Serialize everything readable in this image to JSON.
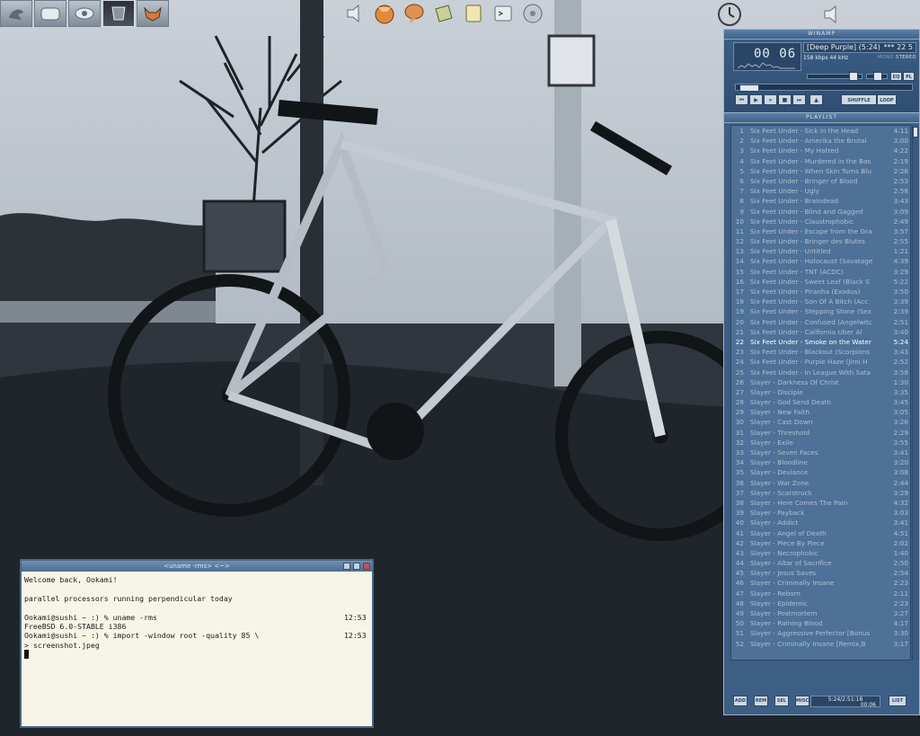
{
  "winamp": {
    "title": "WINAMP",
    "time": "00 06",
    "song": "[Deep Purple] (5:24)",
    "song_extra": "*** 22 5",
    "kbps": "158 kbps  44 kHz",
    "mono": "MONO",
    "stereo": "STEREO",
    "eq_label": "EQ",
    "pl_label": "PL",
    "shuffle_label": "SHUFFLE",
    "loop_label": "LOOP",
    "transport": [
      "⏮",
      "▶",
      "⏸",
      "■",
      "⏭",
      "▲"
    ],
    "position_fraction": 0.02
  },
  "playlist": {
    "title": "PLAYLIST",
    "current_index": 22,
    "items": [
      {
        "n": "1",
        "title": "Six Feet Under - Sick in the Head",
        "dur": "4:11"
      },
      {
        "n": "2",
        "title": "Six Feet Under - Amerika the Brutal",
        "dur": "3:00"
      },
      {
        "n": "3",
        "title": "Six Feet Under - My Hatred",
        "dur": "4:22"
      },
      {
        "n": "4",
        "title": "Six Feet Under - Murdered in the Bas",
        "dur": "2:19"
      },
      {
        "n": "5",
        "title": "Six Feet Under - When Skin Turns Blu",
        "dur": "2:26"
      },
      {
        "n": "6",
        "title": "Six Feet Under - Bringer of Blood",
        "dur": "2:53"
      },
      {
        "n": "7",
        "title": "Six Feet Under - Ugly",
        "dur": "2:58"
      },
      {
        "n": "8",
        "title": "Six Feet Under - Braindead",
        "dur": "3:43"
      },
      {
        "n": "9",
        "title": "Six Feet Under - Blind and Gagged",
        "dur": "3:09"
      },
      {
        "n": "10",
        "title": "Six Feet Under - Claustrophobic",
        "dur": "2:49"
      },
      {
        "n": "11",
        "title": "Six Feet Under - Escape from the Gra",
        "dur": "3:57"
      },
      {
        "n": "12",
        "title": "Six Feet Under - Bringer des Blutes",
        "dur": "2:55"
      },
      {
        "n": "13",
        "title": "Six Feet Under - Untitled",
        "dur": "1:21"
      },
      {
        "n": "14",
        "title": "Six Feet Under - Holocaust (Savatage",
        "dur": "4:39"
      },
      {
        "n": "15",
        "title": "Six Feet Under - TNT (ACDC)",
        "dur": "3:29"
      },
      {
        "n": "16",
        "title": "Six Feet Under - Sweet Leaf (Black S",
        "dur": "5:22"
      },
      {
        "n": "17",
        "title": "Six Feet Under - Piranha (Exodus)",
        "dur": "3:50"
      },
      {
        "n": "18",
        "title": "Six Feet Under - Son Of A Bitch (Acc",
        "dur": "3:39"
      },
      {
        "n": "19",
        "title": "Six Feet Under - Stepping Stone (Sex",
        "dur": "2:39"
      },
      {
        "n": "20",
        "title": "Six Feet Under - Confused (Angelwitc",
        "dur": "2:51"
      },
      {
        "n": "21",
        "title": "Six Feet Under - California Uber Al",
        "dur": "3:40"
      },
      {
        "n": "22",
        "title": "Six Feet Under - Smoke on the Water",
        "dur": "5:24"
      },
      {
        "n": "23",
        "title": "Six Feet Under - Blackout (Scorpions",
        "dur": "3:43"
      },
      {
        "n": "24",
        "title": "Six Feet Under - Purple Haze (Jimi H",
        "dur": "2:52"
      },
      {
        "n": "25",
        "title": "Six Feet Under - In League With Sata",
        "dur": "3:58"
      },
      {
        "n": "26",
        "title": "Slayer - Darkness Of Christ",
        "dur": "1:30"
      },
      {
        "n": "27",
        "title": "Slayer - Disciple",
        "dur": "3:35"
      },
      {
        "n": "28",
        "title": "Slayer - God Send Death",
        "dur": "3:45"
      },
      {
        "n": "29",
        "title": "Slayer - New Faith",
        "dur": "3:05"
      },
      {
        "n": "30",
        "title": "Slayer - Cast Down",
        "dur": "3:26"
      },
      {
        "n": "31",
        "title": "Slayer - Threshold",
        "dur": "2:29"
      },
      {
        "n": "32",
        "title": "Slayer - Exile",
        "dur": "3:55"
      },
      {
        "n": "33",
        "title": "Slayer - Seven Faces",
        "dur": "3:41"
      },
      {
        "n": "34",
        "title": "Slayer - Bloodline",
        "dur": "3:20"
      },
      {
        "n": "35",
        "title": "Slayer - Deviance",
        "dur": "3:08"
      },
      {
        "n": "36",
        "title": "Slayer - War Zone",
        "dur": "2:44"
      },
      {
        "n": "37",
        "title": "Slayer - Scarstruck",
        "dur": "3:29"
      },
      {
        "n": "38",
        "title": "Slayer - Here Comes The Pain",
        "dur": "4:32"
      },
      {
        "n": "39",
        "title": "Slayer - Payback",
        "dur": "3:03"
      },
      {
        "n": "40",
        "title": "Slayer - Addict",
        "dur": "3:41"
      },
      {
        "n": "41",
        "title": "Slayer - Angel of Death",
        "dur": "4:51"
      },
      {
        "n": "42",
        "title": "Slayer - Piece By Piece",
        "dur": "2:02"
      },
      {
        "n": "43",
        "title": "Slayer - Necrophobic",
        "dur": "1:40"
      },
      {
        "n": "44",
        "title": "Slayer - Altar of Sacrifice",
        "dur": "2:50"
      },
      {
        "n": "45",
        "title": "Slayer - Jesus Saves",
        "dur": "2:54"
      },
      {
        "n": "46",
        "title": "Slayer - Criminally Insane",
        "dur": "2:23"
      },
      {
        "n": "47",
        "title": "Slayer - Reborn",
        "dur": "2:11"
      },
      {
        "n": "48",
        "title": "Slayer - Epidemic",
        "dur": "2:23"
      },
      {
        "n": "49",
        "title": "Slayer - Postmortem",
        "dur": "3:27"
      },
      {
        "n": "50",
        "title": "Slayer - Raining Blood",
        "dur": "4:17"
      },
      {
        "n": "51",
        "title": "Slayer - Aggressive Perfector [Bonus",
        "dur": "3:30"
      },
      {
        "n": "52",
        "title": "Slayer - Criminally Insane [Remix,B",
        "dur": "3:17"
      }
    ],
    "buttons": {
      "add": "ADD",
      "rem": "REM",
      "sel": "SEL",
      "misc": "MISC",
      "list": "LIST"
    },
    "time_total": "5:24/2:51:18",
    "time_now": "00:06"
  },
  "terminal": {
    "title": "<uname -rms>  <~>",
    "lines": [
      {
        "text": "Welcome back, Ookami!",
        "time": ""
      },
      {
        "text": "",
        "time": ""
      },
      {
        "text": "parallel processors running perpendicular today",
        "time": ""
      },
      {
        "text": "",
        "time": ""
      },
      {
        "text": "Ookami@sushi ~ :) % uname -rms",
        "time": "12:53"
      },
      {
        "text": "FreeBSD 6.0-STABLE i386",
        "time": ""
      },
      {
        "text": "Ookami@sushi ~ :) % import -window root -quality 85 \\",
        "time": "12:53"
      },
      {
        "text": "> screenshot.jpeg",
        "time": ""
      }
    ]
  },
  "icons": {
    "pager": [
      "bird-icon",
      "glass-icon",
      "eye-icon",
      "mirror-icon",
      "fox-icon"
    ],
    "launcher": [
      "speaker-icon",
      "firefox-icon",
      "chat-icon",
      "book-icon",
      "notepad-icon",
      "terminal-icon",
      "cd-icon"
    ]
  },
  "colors": {
    "winamp_bg": "#3e5f85",
    "terminal_bg": "#f7f6e6",
    "current_track": "#ffffff"
  }
}
